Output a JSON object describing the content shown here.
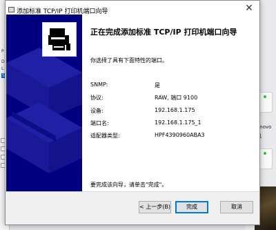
{
  "dialog": {
    "title": "添加标准 TCP/IP 打印机端口向导",
    "close_glyph": "✕",
    "heading": "正在完成添加标准 TCP/IP 打印机端口向导",
    "intro": "你选择了具有下面特性的端口。",
    "properties": [
      {
        "key": "SNMP:",
        "value": "是"
      },
      {
        "key": "协议:",
        "value": "RAW, 端口 9100"
      },
      {
        "key": "设备:",
        "value": "192.168.1.175"
      },
      {
        "key": "端口名:",
        "value": "192.168.1.175_1"
      },
      {
        "key": "适配器类型:",
        "value": "HPF4390960ABA3"
      }
    ],
    "finish_hint": "要完成该向导，请单击\"完成\"。",
    "buttons": {
      "back": "< 上一步(B)",
      "finish": "完成",
      "cancel": "取消"
    }
  },
  "background": {
    "left_letters": [
      "P",
      "D",
      "L",
      "S"
    ],
    "right_labels": [
      "enovo",
      "机"
    ]
  },
  "colors": {
    "side_panel": "#000080",
    "focus_border": "#0078d7"
  },
  "icons": {
    "wizard": "printer-port-wizard-icon",
    "close": "close-icon"
  }
}
